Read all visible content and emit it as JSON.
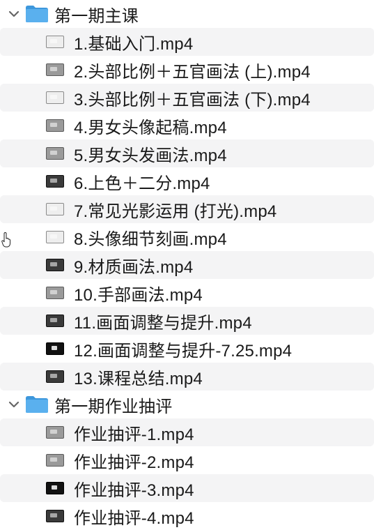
{
  "colors": {
    "folder_blue": "#5ab0ee",
    "folder_blue_dark": "#3d97dc",
    "row_alt": "#f4f4f5",
    "text": "#1a1a1a"
  },
  "folders": [
    {
      "name": "第一期主课",
      "icon": "folder-icon",
      "expanded": true,
      "files": [
        {
          "name": "1.基础入门.mp4",
          "thumb": "light"
        },
        {
          "name": "2.头部比例＋五官画法 (上).mp4",
          "thumb": "gray"
        },
        {
          "name": "3.头部比例＋五官画法 (下).mp4",
          "thumb": "light"
        },
        {
          "name": "4.男女头像起稿.mp4",
          "thumb": "gray"
        },
        {
          "name": "5.男女头发画法.mp4",
          "thumb": "gray"
        },
        {
          "name": "6.上色＋二分.mp4",
          "thumb": "dark"
        },
        {
          "name": "7.常见光影运用 (打光).mp4",
          "thumb": "light"
        },
        {
          "name": "8.头像细节刻画.mp4",
          "thumb": "light"
        },
        {
          "name": "9.材质画法.mp4",
          "thumb": "dark"
        },
        {
          "name": "10.手部画法.mp4",
          "thumb": "gray"
        },
        {
          "name": "11.画面调整与提升.mp4",
          "thumb": "dark"
        },
        {
          "name": "12.画面调整与提升-7.25.mp4",
          "thumb": "black"
        },
        {
          "name": "13.课程总结.mp4",
          "thumb": "dark"
        }
      ]
    },
    {
      "name": "第一期作业抽评",
      "icon": "folder-icon",
      "expanded": true,
      "files": [
        {
          "name": "作业抽评-1.mp4",
          "thumb": "gray"
        },
        {
          "name": "作业抽评-2.mp4",
          "thumb": "gray"
        },
        {
          "name": "作业抽评-3.mp4",
          "thumb": "black"
        },
        {
          "name": "作业抽评-4.mp4",
          "thumb": "dark"
        }
      ]
    }
  ]
}
